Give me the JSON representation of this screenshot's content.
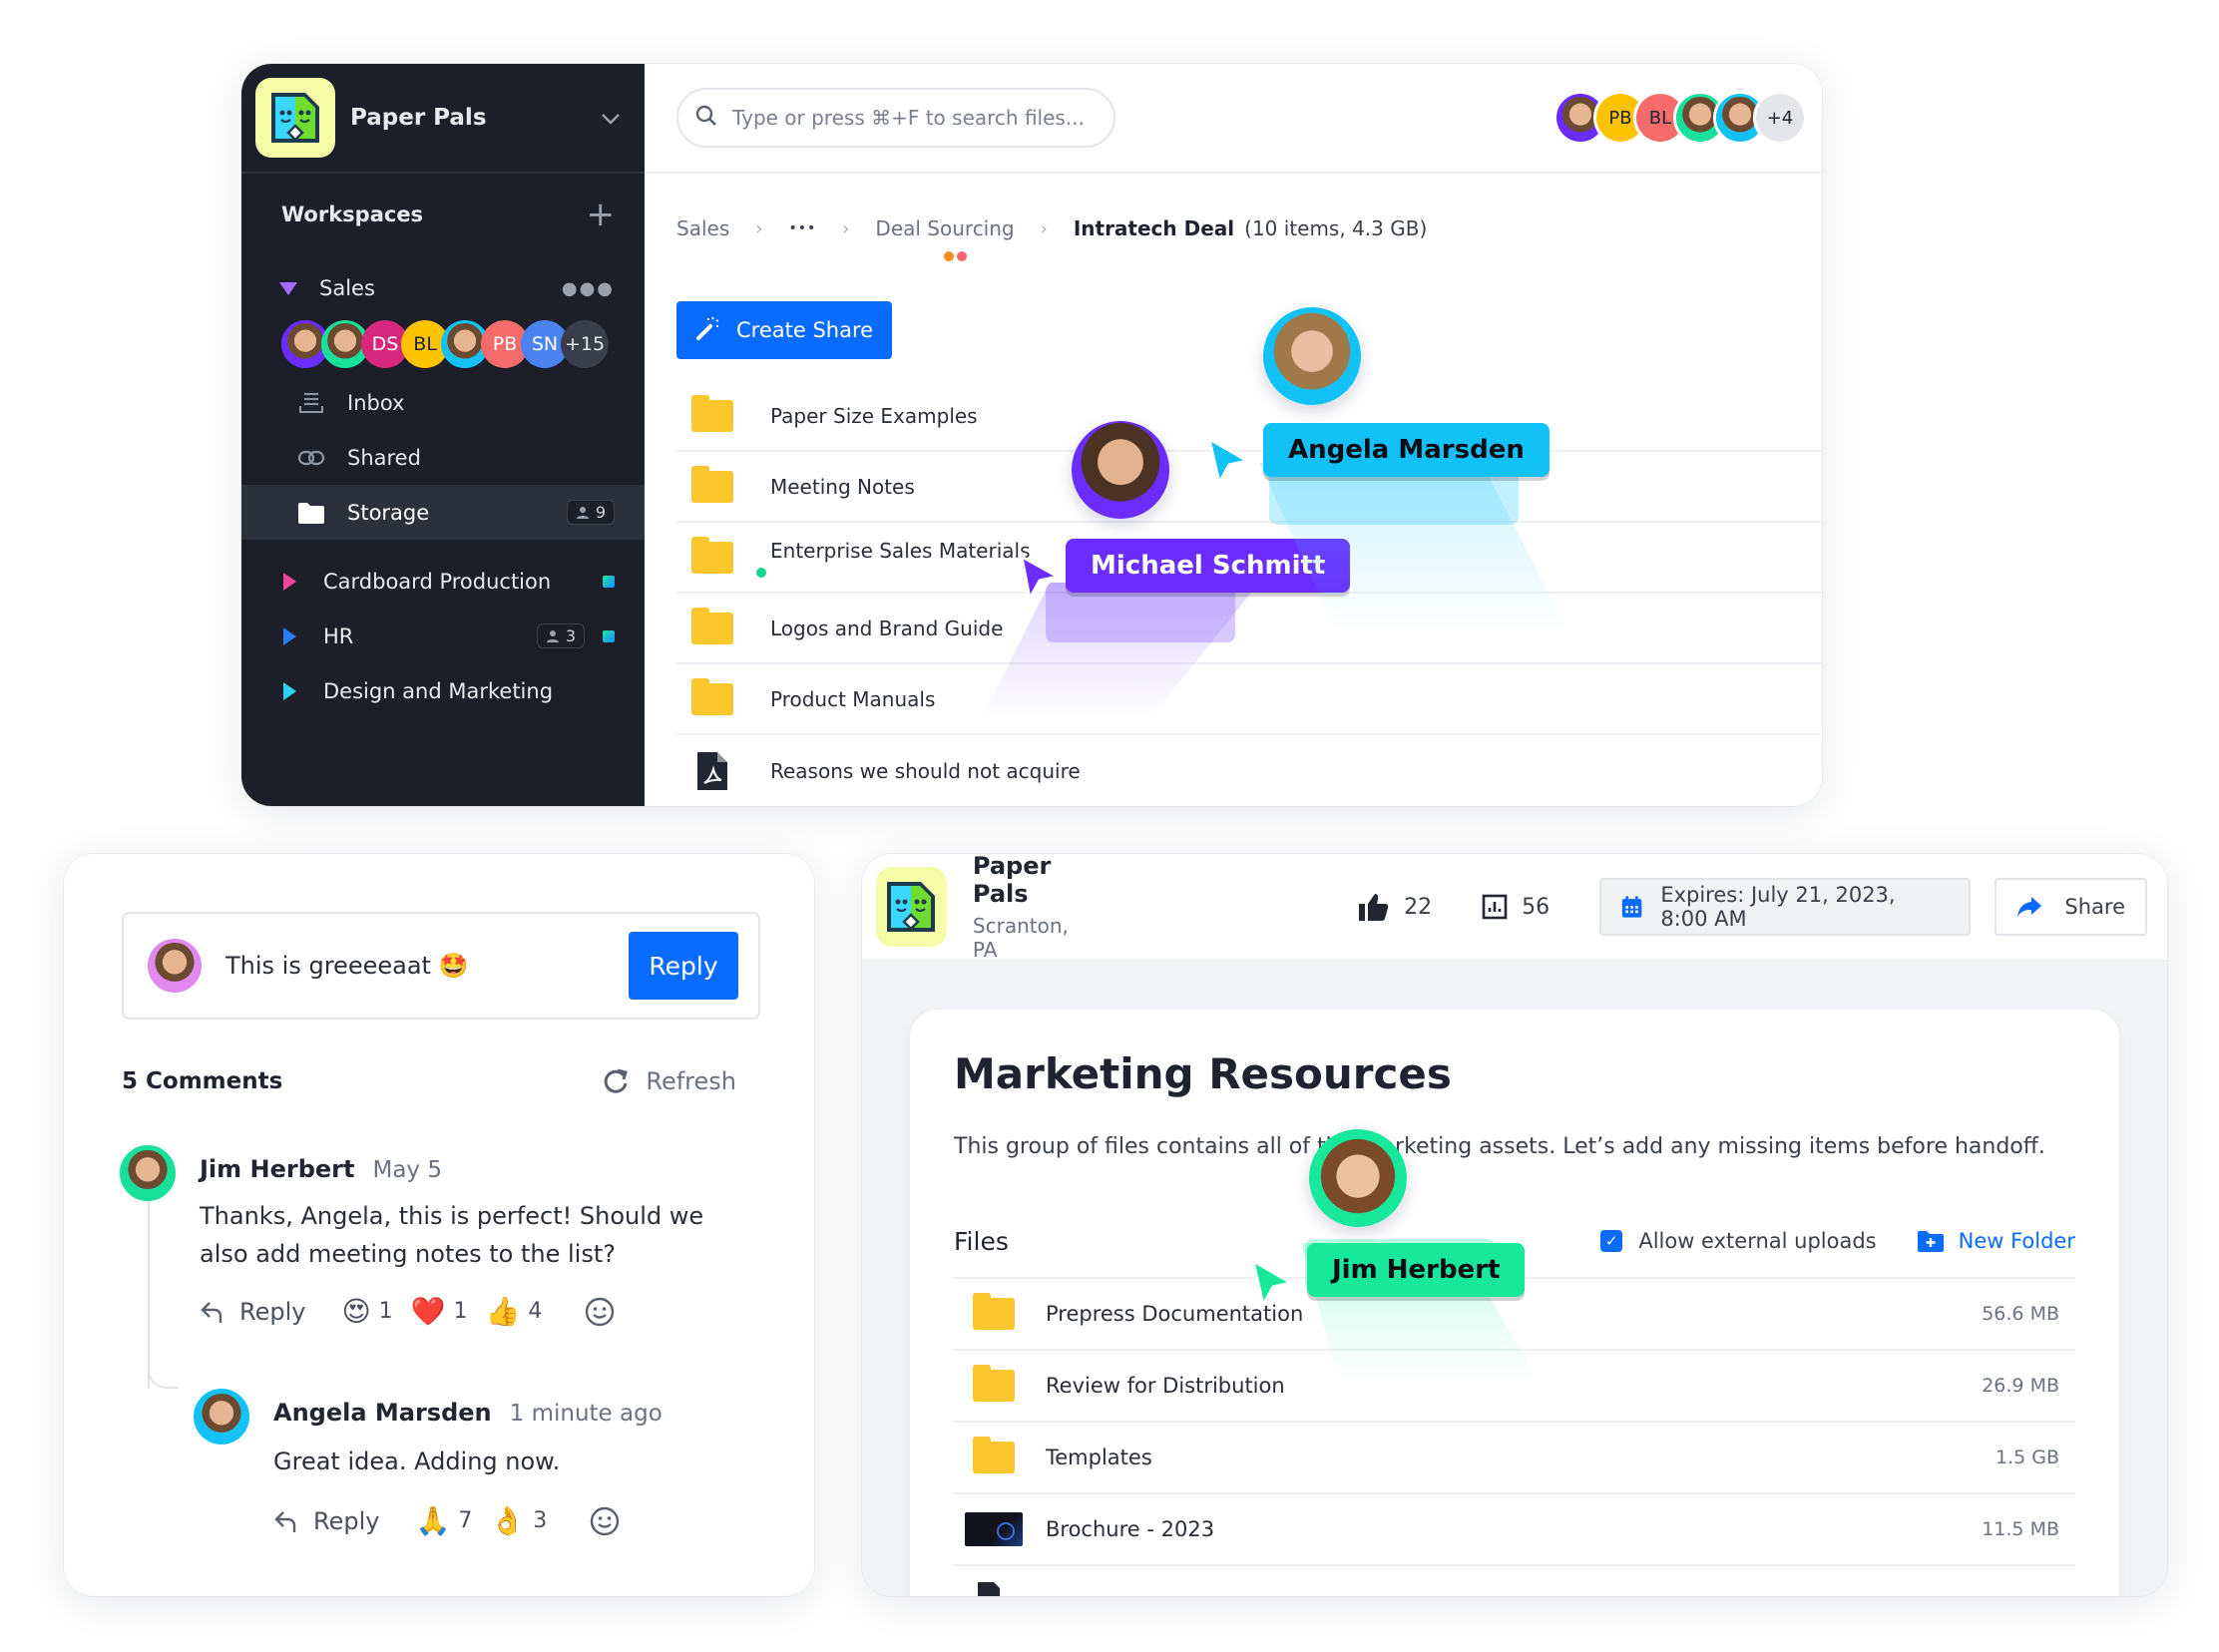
{
  "app": {
    "workspace_name": "Paper Pals",
    "sidebar": {
      "workspaces_label": "Workspaces",
      "groups": [
        {
          "label": "Sales",
          "expanded": true,
          "color": "#a26bff",
          "members": [
            {
              "type": "photo",
              "border": "#6a2cff"
            },
            {
              "type": "photo",
              "border": "#17e09a"
            },
            {
              "type": "initials",
              "text": "DS",
              "bg": "#d6287c"
            },
            {
              "type": "initials",
              "text": "BL",
              "bg": "#fec300"
            },
            {
              "type": "photo",
              "border": "#14c3f5"
            },
            {
              "type": "initials",
              "text": "PB",
              "bg": "#f56b6b"
            },
            {
              "type": "initials",
              "text": "SN",
              "bg": "#4a82f0"
            },
            {
              "type": "more",
              "text": "+15",
              "bg": "#3a3e4a"
            }
          ],
          "items": [
            {
              "label": "Inbox",
              "icon": "inbox-icon"
            },
            {
              "label": "Shared",
              "icon": "link-icon"
            },
            {
              "label": "Storage",
              "icon": "folder-icon",
              "active": true,
              "badge": "9"
            }
          ]
        }
      ],
      "projects": [
        {
          "label": "Cardboard Production",
          "color": "#f0479a",
          "status": true
        },
        {
          "label": "HR",
          "color": "#2a7cf5",
          "badge": "3",
          "status": true
        },
        {
          "label": "Design and Marketing",
          "color": "#2fd3f5"
        }
      ]
    },
    "search": {
      "placeholder": "Type or press ⌘+F to search files..."
    },
    "top_avatars": [
      {
        "type": "photo",
        "border": "#6a2cff"
      },
      {
        "type": "initials",
        "text": "PB",
        "bg": "#fec300"
      },
      {
        "type": "initials",
        "text": "BL",
        "bg": "#f56b6b"
      },
      {
        "type": "photo",
        "border": "#17e09a"
      },
      {
        "type": "photo",
        "border": "#14c3f5"
      },
      {
        "type": "more",
        "text": "+4",
        "bg": "#e4e6ea"
      }
    ],
    "breadcrumb": {
      "items": [
        "Sales",
        "•••",
        "Deal Sourcing"
      ],
      "current": "Intratech Deal",
      "meta": "(10 items, 4.3 GB)",
      "presence_dots": [
        "#f7901e",
        "#f56b6b"
      ]
    },
    "create_share_label": "Create Share",
    "files": [
      {
        "name": "Paper Size Examples",
        "type": "folder"
      },
      {
        "name": "Meeting Notes",
        "type": "folder"
      },
      {
        "name": "Enterprise Sales Materials",
        "type": "folder",
        "online_dot": true
      },
      {
        "name": "Logos and Brand Guide",
        "type": "folder"
      },
      {
        "name": "Product Manuals",
        "type": "folder"
      },
      {
        "name": "Reasons we should not acquire",
        "type": "pdf"
      }
    ],
    "cursors": [
      {
        "name": "Angela Marsden",
        "color": "#12c2f7",
        "text_color": "#0c0c12"
      },
      {
        "name": "Michael Schmitt",
        "color": "#6a2cff",
        "text_color": "#ffffff"
      }
    ]
  },
  "comments": {
    "composer": {
      "value": "This is greeeeaat 🤩",
      "submit_label": "Reply"
    },
    "count_label": "5 Comments",
    "refresh_label": "Refresh",
    "items": [
      {
        "author": "Jim Herbert",
        "time": "May 5",
        "avatar_border": "#17e09a",
        "body": "Thanks, Angela, this is perfect! Should we also add meeting notes to the list?",
        "reply_label": "Reply",
        "reactions": [
          {
            "emoji": "😍",
            "count": "1"
          },
          {
            "emoji": "❤️",
            "count": "1"
          },
          {
            "emoji": "👍",
            "count": "4"
          }
        ]
      },
      {
        "author": "Angela Marsden",
        "time": "1 minute ago",
        "avatar_border": "#14c3f5",
        "body": "Great idea. Adding now.",
        "reply_label": "Reply",
        "reactions": [
          {
            "emoji": "🙏",
            "count": "7"
          },
          {
            "emoji": "👌",
            "count": "3"
          }
        ]
      }
    ]
  },
  "share": {
    "org_name": "Paper Pals",
    "org_location": "Scranton, PA",
    "likes": "22",
    "views": "56",
    "expires_label": "Expires: July 21, 2023, 8:00 AM",
    "share_label": "Share",
    "title": "Marketing Resources",
    "description": "This group of files contains all of the marketing assets. Let’s add any missing items before handoff.",
    "files_label": "Files",
    "allow_uploads_label": "Allow external uploads",
    "allow_uploads_checked": true,
    "new_folder_label": "New Folder",
    "files": [
      {
        "name": "Prepress Documentation",
        "size": "56.6 MB",
        "type": "folder"
      },
      {
        "name": "Review for Distribution",
        "size": "26.9 MB",
        "type": "folder"
      },
      {
        "name": "Templates",
        "size": "1.5 GB",
        "type": "folder"
      },
      {
        "name": "Brochure - 2023",
        "size": "11.5 MB",
        "type": "image"
      }
    ],
    "cursor": {
      "name": "Jim Herbert",
      "color": "#17e89c",
      "text_color": "#0c0c12"
    }
  }
}
